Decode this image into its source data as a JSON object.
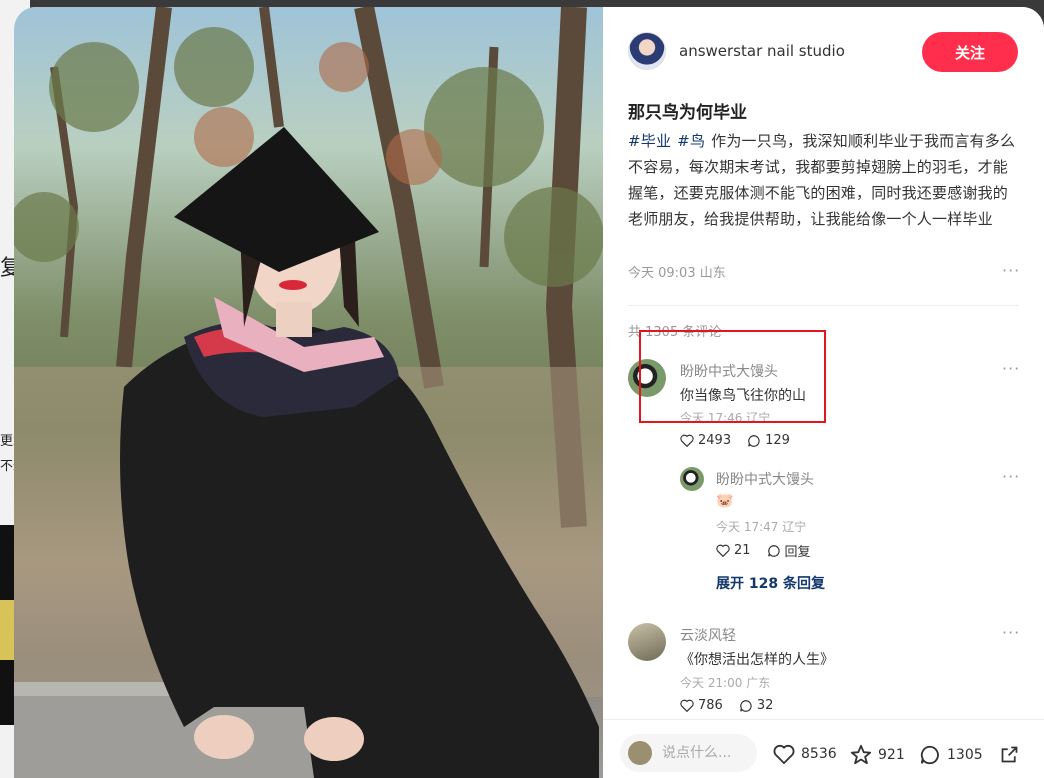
{
  "background_page": {
    "left_char": "复",
    "left_small1": "更承",
    "left_small2": "不过"
  },
  "author": {
    "name": "answerstar nail studio",
    "follow_label": "关注"
  },
  "note": {
    "title": "那只鸟为何毕业",
    "tags": [
      "#毕业",
      "#鸟"
    ],
    "body": "作为一只鸟，我深知顺利毕业于我而言有多么不容易，每次期末考试，我都要剪掉翅膀上的羽毛，才能握笔，还要克服体测不能飞的困难，同时我还要感谢我的老师朋友，给我提供帮助，让我能给像一个人一样毕业",
    "meta": "今天 09:03 山东",
    "more": "···"
  },
  "comments_header": "共 1305 条评论",
  "comments": [
    {
      "user": "盼盼中式大馒头",
      "text": "你当像鸟飞往你的山",
      "time": "今天 17:46 辽宁",
      "likes": "2493",
      "replies": "129",
      "more": "···"
    },
    {
      "user": "盼盼中式大馒头",
      "text": "🐷",
      "time": "今天 17:47 辽宁",
      "likes": "21",
      "replies": "回复",
      "more": "···"
    },
    {
      "user": "云淡风轻",
      "text": "《你想活出怎样的人生》",
      "time": "今天 21:00 广东",
      "likes": "786",
      "replies": "32",
      "more": "···"
    }
  ],
  "expand_replies": "展开 128 条回复",
  "bottom_bar": {
    "input_placeholder": "说点什么...",
    "likes": "8536",
    "collects": "921",
    "comments": "1305"
  },
  "icons": {
    "like": "heart-icon",
    "collect": "star-icon",
    "comment": "chat-bubble-icon",
    "share": "share-icon"
  },
  "colors": {
    "follow_button": "#ff2e4d",
    "tag_link": "#13386c",
    "highlight_box": "#e3161e"
  }
}
